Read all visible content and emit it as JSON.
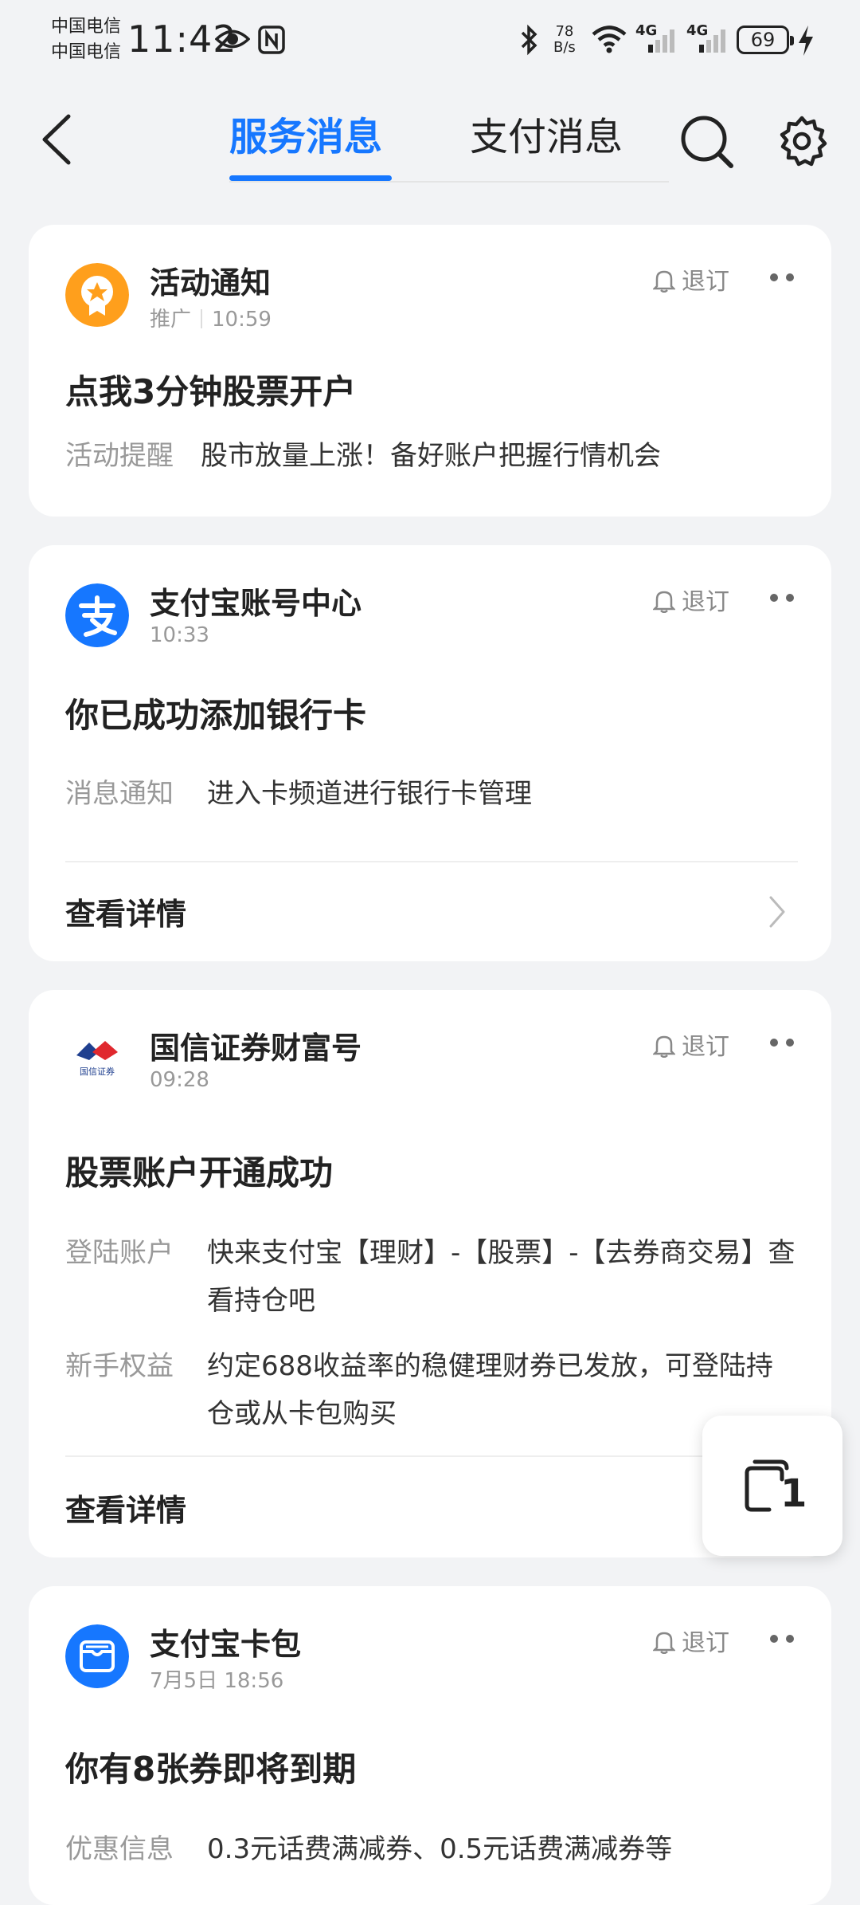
{
  "status_bar": {
    "carrier_1": "中国电信",
    "carrier_2": "中国电信",
    "time": "11:42",
    "net_speed_value": "78",
    "net_speed_unit": "B/s",
    "signal_1": "4G",
    "signal_2": "4G",
    "battery": "69",
    "icons": [
      "eye-icon",
      "nfc-icon",
      "bluetooth-icon",
      "wifi-icon",
      "signal-icon",
      "charging-icon"
    ]
  },
  "nav": {
    "tabs": [
      {
        "label": "服务消息",
        "active": true
      },
      {
        "label": "支付消息",
        "active": false
      }
    ],
    "accent_color": "#1677ff"
  },
  "cards": [
    {
      "sender": "活动通知",
      "tag": "推广",
      "time": "10:59",
      "unsubscribe": "退订",
      "title": "点我3分钟股票开户",
      "details": [
        {
          "label": "活动提醒",
          "value": "股市放量上涨！备好账户把握行情机会"
        }
      ]
    },
    {
      "sender": "支付宝账号中心",
      "time": "10:33",
      "unsubscribe": "退订",
      "title": "你已成功添加银行卡",
      "details": [
        {
          "label": "消息通知",
          "value": "进入卡频道进行银行卡管理"
        }
      ],
      "view_details": "查看详情"
    },
    {
      "sender": "国信证券财富号",
      "time": "09:28",
      "unsubscribe": "退订",
      "title": "股票账户开通成功",
      "details": [
        {
          "label": "登陆账户",
          "value": "快来支付宝【理财】-【股票】-【去券商交易】查看持仓吧"
        },
        {
          "label": "新手权益",
          "value": "约定688收益率的稳健理财券已发放，可登陆持仓或从卡包购买"
        }
      ],
      "view_details": "查看详情",
      "logo_text": "国信证券"
    },
    {
      "sender": "支付宝卡包",
      "time": "7月5日 18:56",
      "unsubscribe": "退订",
      "title": "你有8张券即将到期",
      "details": [
        {
          "label": "优惠信息",
          "value": "0.3元话费满减券、0.5元话费满减券等"
        }
      ]
    }
  ],
  "floating_button": {
    "count": "1",
    "icon": "copy-icon"
  }
}
